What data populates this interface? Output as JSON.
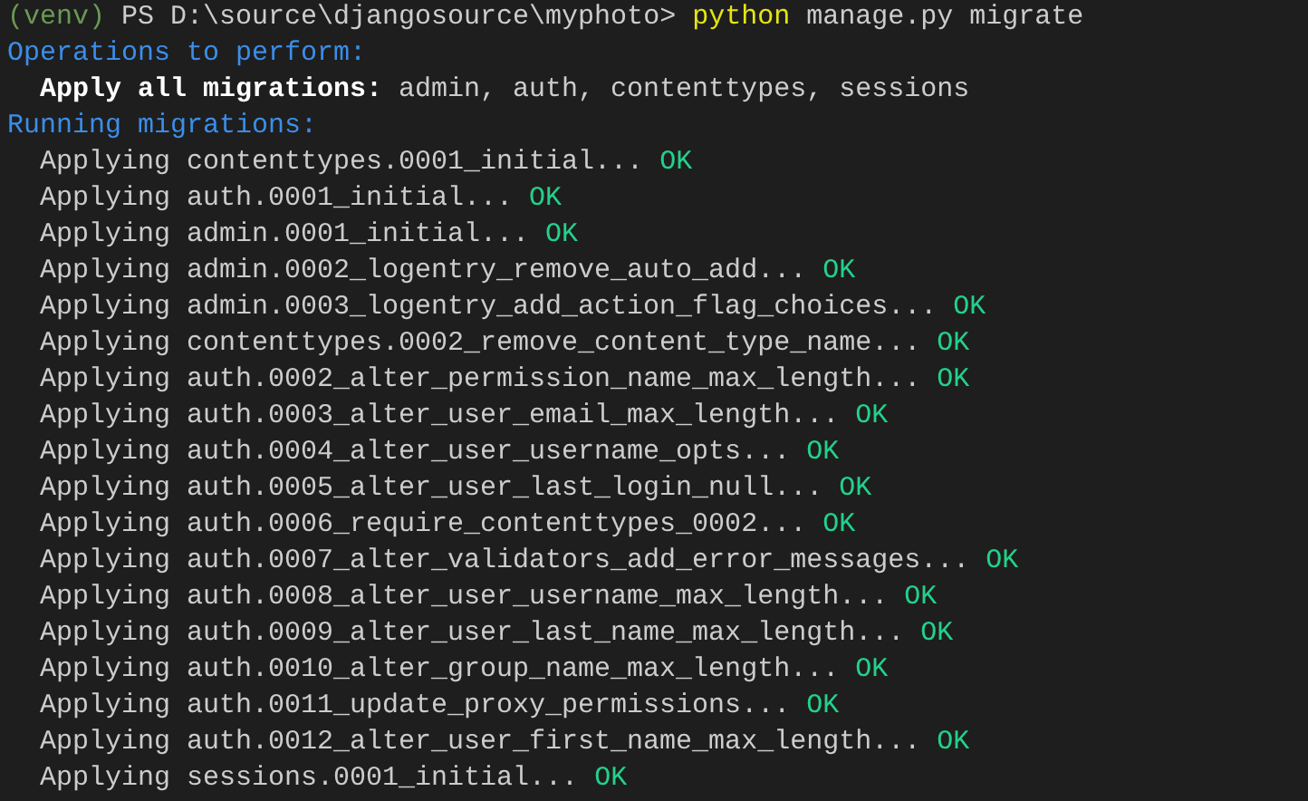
{
  "terminal": {
    "lines": [
      {
        "kind": "prompt",
        "env": "(venv)",
        "path": "PS D:\\source\\djangosource\\myphoto>",
        "command": "python",
        "args": "manage.py migrate"
      },
      {
        "kind": "heading",
        "text": "Operations to perform:"
      },
      {
        "kind": "summary",
        "label": "Apply all migrations:",
        "text": "admin, auth, contenttypes, sessions"
      },
      {
        "kind": "heading",
        "text": "Running migrations:"
      },
      {
        "kind": "migration",
        "text": "Applying contenttypes.0001_initial...",
        "status": "OK"
      },
      {
        "kind": "migration",
        "text": "Applying auth.0001_initial...",
        "status": "OK"
      },
      {
        "kind": "migration",
        "text": "Applying admin.0001_initial...",
        "status": "OK"
      },
      {
        "kind": "migration",
        "text": "Applying admin.0002_logentry_remove_auto_add...",
        "status": "OK"
      },
      {
        "kind": "migration",
        "text": "Applying admin.0003_logentry_add_action_flag_choices...",
        "status": "OK"
      },
      {
        "kind": "migration",
        "text": "Applying contenttypes.0002_remove_content_type_name...",
        "status": "OK"
      },
      {
        "kind": "migration",
        "text": "Applying auth.0002_alter_permission_name_max_length...",
        "status": "OK"
      },
      {
        "kind": "migration",
        "text": "Applying auth.0003_alter_user_email_max_length...",
        "status": "OK"
      },
      {
        "kind": "migration",
        "text": "Applying auth.0004_alter_user_username_opts...",
        "status": "OK"
      },
      {
        "kind": "migration",
        "text": "Applying auth.0005_alter_user_last_login_null...",
        "status": "OK"
      },
      {
        "kind": "migration",
        "text": "Applying auth.0006_require_contenttypes_0002...",
        "status": "OK"
      },
      {
        "kind": "migration",
        "text": "Applying auth.0007_alter_validators_add_error_messages...",
        "status": "OK"
      },
      {
        "kind": "migration",
        "text": "Applying auth.0008_alter_user_username_max_length...",
        "status": "OK"
      },
      {
        "kind": "migration",
        "text": "Applying auth.0009_alter_user_last_name_max_length...",
        "status": "OK"
      },
      {
        "kind": "migration",
        "text": "Applying auth.0010_alter_group_name_max_length...",
        "status": "OK"
      },
      {
        "kind": "migration",
        "text": "Applying auth.0011_update_proxy_permissions...",
        "status": "OK"
      },
      {
        "kind": "migration",
        "text": "Applying auth.0012_alter_user_first_name_max_length...",
        "status": "OK"
      },
      {
        "kind": "migration",
        "text": "Applying sessions.0001_initial...",
        "status": "OK"
      }
    ]
  }
}
